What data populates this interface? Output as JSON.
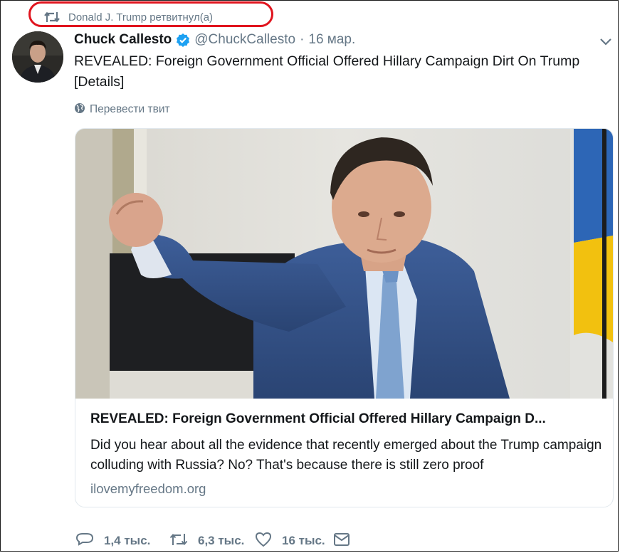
{
  "retweet_header": {
    "text": "Donald J. Trump ретвитнул(а)",
    "icon": "retweet-icon"
  },
  "tweet": {
    "author_name": "Chuck Callesto",
    "verified": true,
    "handle": "@ChuckCallesto",
    "separator": "·",
    "date": "16 мар.",
    "text": "REVEALED: Foreign Government Official Offered Hillary Campaign Dirt On Trump [Details]",
    "translate_label": "Перевести твит"
  },
  "card": {
    "title": "REVEALED: Foreign Government Official Offered Hillary Campaign D...",
    "description": "Did you hear about all the evidence that recently emerged about the Trump campaign colluding with Russia? No? That's because there is still zero proof",
    "domain": "ilovemyfreedom.org"
  },
  "actions": {
    "replies": "1,4 тыс.",
    "retweets": "6,3 тыс.",
    "likes": "16 тыс."
  },
  "colors": {
    "highlight_oval": "#e0141e",
    "secondary_text": "#657786",
    "verified_badge": "#1da1f2",
    "primary_text": "#14171a",
    "card_border": "#e1e8ed"
  }
}
